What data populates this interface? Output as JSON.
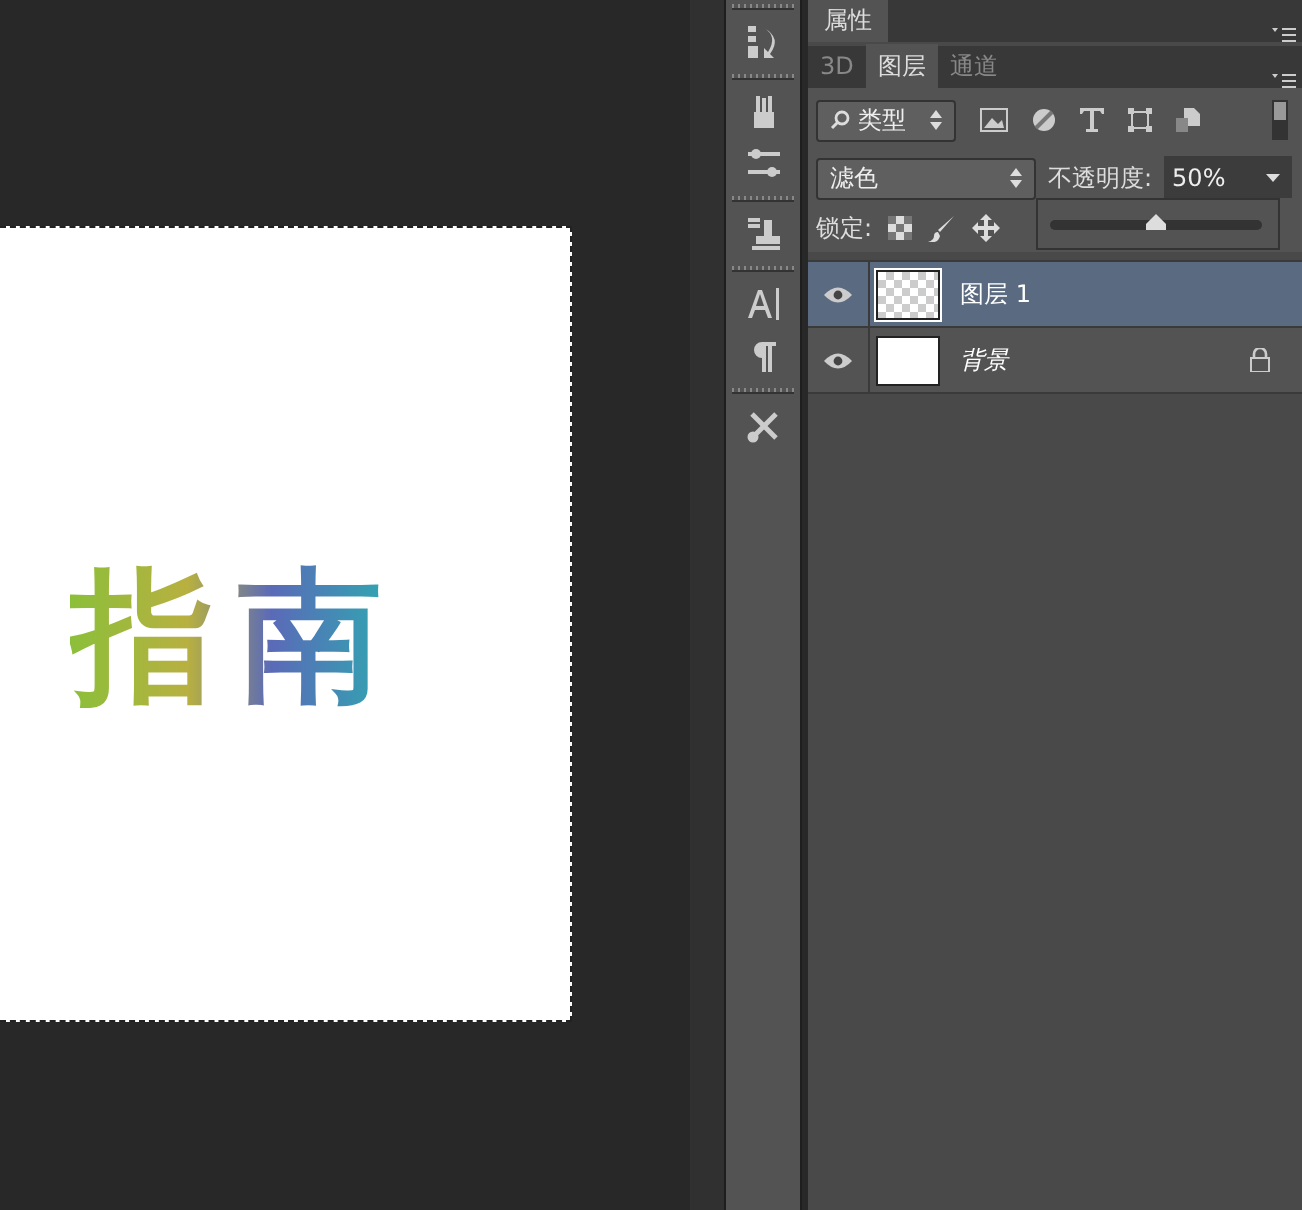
{
  "properties_panel": {
    "title": "属性"
  },
  "tabs": [
    {
      "label": "3D",
      "selected": false
    },
    {
      "label": "图层",
      "selected": true
    },
    {
      "label": "通道",
      "selected": false
    }
  ],
  "filter": {
    "value": "类型"
  },
  "blend_mode": {
    "value": "滤色"
  },
  "opacity": {
    "label": "不透明度:",
    "value": "50%",
    "level": 0.5
  },
  "lock": {
    "label": "锁定:"
  },
  "layers": [
    {
      "name": "图层 1",
      "selected": true,
      "visible": true,
      "locked": false,
      "kind": "transparent"
    },
    {
      "name": "背景",
      "selected": false,
      "visible": true,
      "locked": true,
      "kind": "white"
    }
  ],
  "canvas": {
    "text": "指南"
  }
}
